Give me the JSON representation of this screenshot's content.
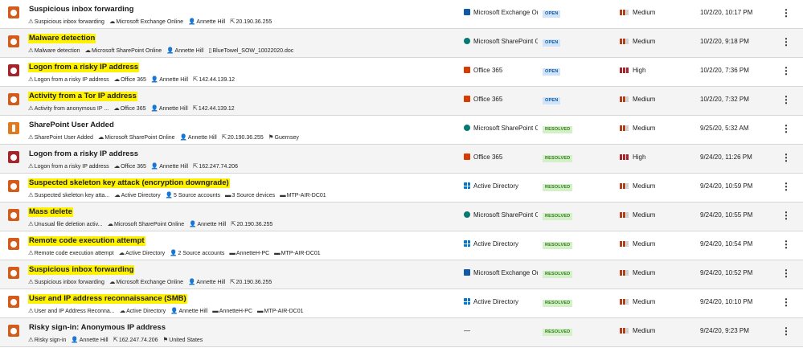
{
  "alerts": [
    {
      "title": "Suspicious inbox forwarding",
      "highlighted": false,
      "severity_icon": "medium",
      "meta": [
        {
          "icon": "alert-type-icon",
          "text": "Suspicious inbox forwarding"
        },
        {
          "icon": "cloud-icon",
          "text": "Microsoft Exchange Online"
        },
        {
          "icon": "user-icon",
          "text": "Annette Hill"
        },
        {
          "icon": "ip-icon",
          "text": "20.190.36.255"
        }
      ],
      "source": {
        "icon": "exchange",
        "text": "Microsoft Exchange Online"
      },
      "status": "OPEN",
      "severity": "Medium",
      "time": "10/2/20, 10:17 PM"
    },
    {
      "title": "Malware detection",
      "highlighted": true,
      "severity_icon": "medium",
      "meta": [
        {
          "icon": "alert-type-icon",
          "text": "Malware detection"
        },
        {
          "icon": "cloud-icon",
          "text": "Microsoft SharePoint Online"
        },
        {
          "icon": "user-icon",
          "text": "Annette Hill"
        },
        {
          "icon": "file-icon",
          "text": "BlueTowel_SOW_10022020.doc"
        }
      ],
      "source": {
        "icon": "sharepoint",
        "text": "Microsoft SharePoint Onl..."
      },
      "status": "OPEN",
      "severity": "Medium",
      "time": "10/2/20, 9:18 PM"
    },
    {
      "title": "Logon from a risky IP address",
      "highlighted": true,
      "severity_icon": "high",
      "meta": [
        {
          "icon": "alert-type-icon",
          "text": "Logon from a risky IP address"
        },
        {
          "icon": "cloud-icon",
          "text": "Office 365"
        },
        {
          "icon": "user-icon",
          "text": "Annette Hill"
        },
        {
          "icon": "ip-icon",
          "text": "142.44.139.12"
        }
      ],
      "source": {
        "icon": "o365",
        "text": "Office 365"
      },
      "status": "OPEN",
      "severity": "High",
      "time": "10/2/20, 7:36 PM"
    },
    {
      "title": "Activity from a Tor IP address",
      "highlighted": true,
      "severity_icon": "medium",
      "meta": [
        {
          "icon": "alert-type-icon",
          "text": "Activity from anonymous IP ..."
        },
        {
          "icon": "cloud-icon",
          "text": "Office 365"
        },
        {
          "icon": "user-icon",
          "text": "Annette Hill"
        },
        {
          "icon": "ip-icon",
          "text": "142.44.139.12"
        }
      ],
      "source": {
        "icon": "o365",
        "text": "Office 365"
      },
      "status": "OPEN",
      "severity": "Medium",
      "time": "10/2/20, 7:32 PM"
    },
    {
      "title": "SharePoint User Added",
      "highlighted": false,
      "severity_icon": "info",
      "meta": [
        {
          "icon": "alert-type-icon",
          "text": "SharePoint User Added"
        },
        {
          "icon": "cloud-icon",
          "text": "Microsoft SharePoint Online"
        },
        {
          "icon": "user-icon",
          "text": "Annette Hill"
        },
        {
          "icon": "ip-icon",
          "text": "20.190.36.255"
        },
        {
          "icon": "flag-icon",
          "text": "Guernsey"
        }
      ],
      "source": {
        "icon": "sharepoint",
        "text": "Microsoft SharePoint Onl..."
      },
      "status": "RESOLVED",
      "severity": "Medium",
      "time": "9/25/20, 5:32 AM"
    },
    {
      "title": "Logon from a risky IP address",
      "highlighted": false,
      "severity_icon": "high",
      "meta": [
        {
          "icon": "alert-type-icon",
          "text": "Logon from a risky IP address"
        },
        {
          "icon": "cloud-icon",
          "text": "Office 365"
        },
        {
          "icon": "user-icon",
          "text": "Annette Hill"
        },
        {
          "icon": "ip-icon",
          "text": "162.247.74.206"
        }
      ],
      "source": {
        "icon": "o365",
        "text": "Office 365"
      },
      "status": "RESOLVED",
      "severity": "High",
      "time": "9/24/20, 11:26 PM"
    },
    {
      "title": "Suspected skeleton key attack (encryption downgrade)",
      "highlighted": true,
      "severity_icon": "medium",
      "meta": [
        {
          "icon": "alert-type-icon",
          "text": "Suspected skeleton key atta..."
        },
        {
          "icon": "cloud-icon",
          "text": "Active Directory"
        },
        {
          "icon": "user-icon",
          "text": "5 Source accounts"
        },
        {
          "icon": "device-icon",
          "text": "3 Source devices"
        },
        {
          "icon": "device-icon",
          "text": "MTP-AIR-DC01"
        }
      ],
      "source": {
        "icon": "ad",
        "text": "Active Directory"
      },
      "status": "RESOLVED",
      "severity": "Medium",
      "time": "9/24/20, 10:59 PM"
    },
    {
      "title": "Mass delete",
      "highlighted": true,
      "severity_icon": "medium",
      "meta": [
        {
          "icon": "alert-type-icon",
          "text": "Unusual file deletion activ..."
        },
        {
          "icon": "cloud-icon",
          "text": "Microsoft SharePoint Online"
        },
        {
          "icon": "user-icon",
          "text": "Annette Hill"
        },
        {
          "icon": "ip-icon",
          "text": "20.190.36.255"
        }
      ],
      "source": {
        "icon": "sharepoint",
        "text": "Microsoft SharePoint Onl..."
      },
      "status": "RESOLVED",
      "severity": "Medium",
      "time": "9/24/20, 10:55 PM"
    },
    {
      "title": "Remote code execution attempt",
      "highlighted": true,
      "severity_icon": "medium",
      "meta": [
        {
          "icon": "alert-type-icon",
          "text": "Remote code execution attempt"
        },
        {
          "icon": "cloud-icon",
          "text": "Active Directory"
        },
        {
          "icon": "user-icon",
          "text": "2 Source accounts"
        },
        {
          "icon": "device-icon",
          "text": "AnnetteH-PC"
        },
        {
          "icon": "device-icon",
          "text": "MTP-AIR-DC01"
        }
      ],
      "source": {
        "icon": "ad",
        "text": "Active Directory"
      },
      "status": "RESOLVED",
      "severity": "Medium",
      "time": "9/24/20, 10:54 PM"
    },
    {
      "title": "Suspicious inbox forwarding",
      "highlighted": true,
      "severity_icon": "medium",
      "meta": [
        {
          "icon": "alert-type-icon",
          "text": "Suspicious inbox forwarding"
        },
        {
          "icon": "cloud-icon",
          "text": "Microsoft Exchange Online"
        },
        {
          "icon": "user-icon",
          "text": "Annette Hill"
        },
        {
          "icon": "ip-icon",
          "text": "20.190.36.255"
        }
      ],
      "source": {
        "icon": "exchange",
        "text": "Microsoft Exchange Online"
      },
      "status": "RESOLVED",
      "severity": "Medium",
      "time": "9/24/20, 10:52 PM"
    },
    {
      "title": "User and IP address reconnaissance (SMB)",
      "highlighted": true,
      "severity_icon": "medium",
      "meta": [
        {
          "icon": "alert-type-icon",
          "text": "User and IP Address Reconna..."
        },
        {
          "icon": "cloud-icon",
          "text": "Active Directory"
        },
        {
          "icon": "user-icon",
          "text": "Annette Hill"
        },
        {
          "icon": "device-icon",
          "text": "AnnetteH-PC"
        },
        {
          "icon": "device-icon",
          "text": "MTP-AIR-DC01"
        }
      ],
      "source": {
        "icon": "ad",
        "text": "Active Directory"
      },
      "status": "RESOLVED",
      "severity": "Medium",
      "time": "9/24/20, 10:10 PM"
    },
    {
      "title": "Risky sign-in: Anonymous IP address",
      "highlighted": false,
      "severity_icon": "medium",
      "meta": [
        {
          "icon": "alert-type-icon",
          "text": "Risky sign-in"
        },
        {
          "icon": "user-icon",
          "text": "Annette Hill"
        },
        {
          "icon": "ip-icon",
          "text": "162.247.74.206"
        },
        {
          "icon": "flag-icon",
          "text": "United States"
        }
      ],
      "source": {
        "icon": "none",
        "text": "—"
      },
      "status": "RESOLVED",
      "severity": "Medium",
      "time": "9/24/20, 9:23 PM"
    }
  ],
  "icon_glyphs": {
    "alert-type-icon": "⚠",
    "cloud-icon": "☁",
    "user-icon": "👤",
    "ip-icon": "⇱",
    "file-icon": "▯",
    "device-icon": "▬",
    "flag-icon": "⚑"
  },
  "menu_glyph": "⋮",
  "colors": {
    "highlight": "#fff200",
    "medium": "#d35c1c",
    "high": "#a4262c",
    "open_badge": "#cfe4fa",
    "resolved_badge": "#d5f0c9"
  }
}
